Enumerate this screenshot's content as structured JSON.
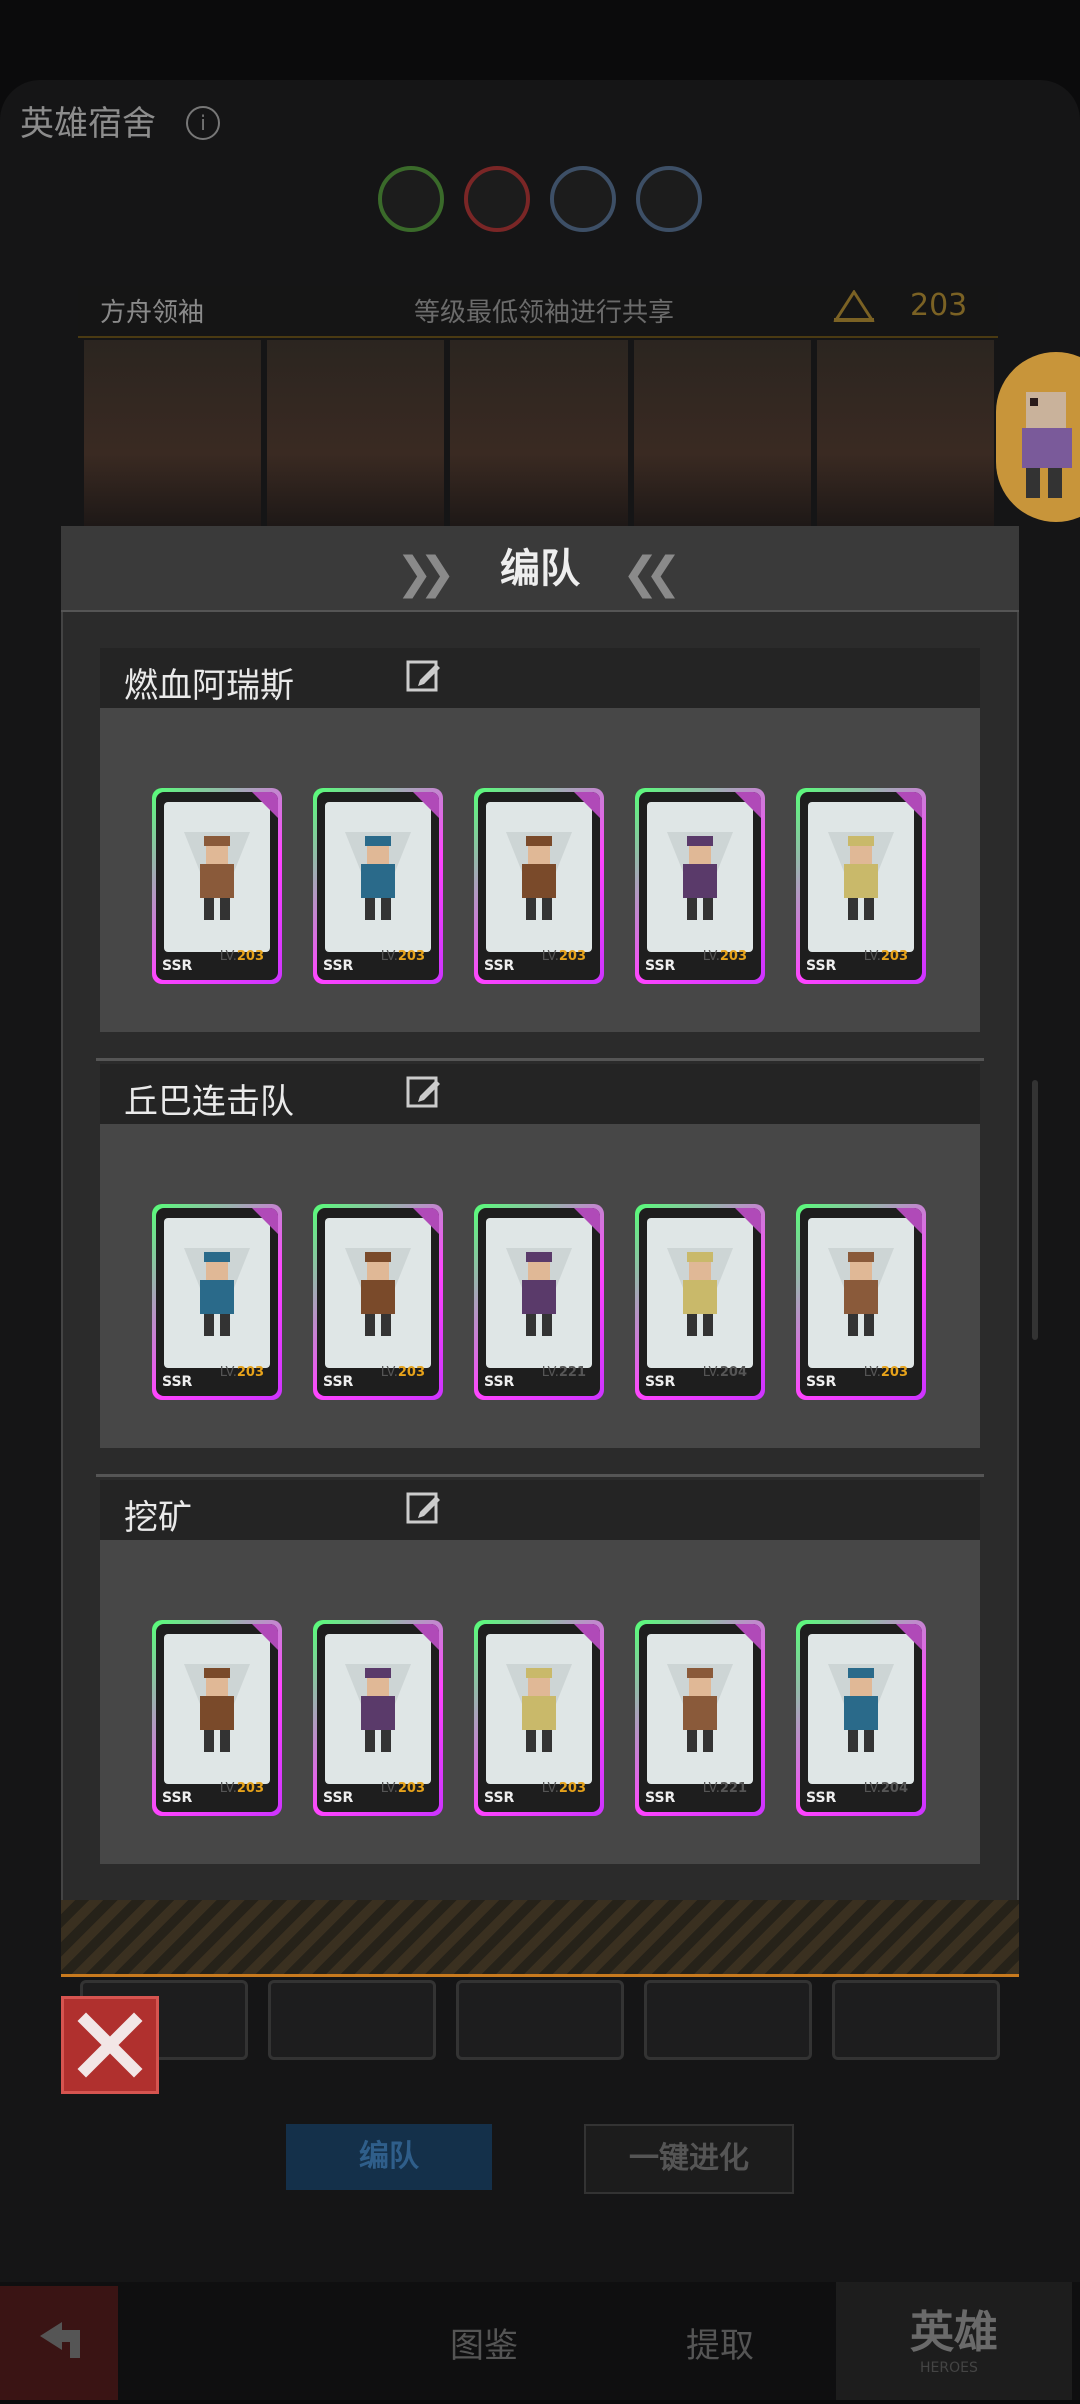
{
  "background": {
    "title": "英雄宿舍",
    "leader": {
      "name": "方舟领袖",
      "desc": "等级最低领袖进行共享",
      "level": "203"
    },
    "tabs": {
      "formation": "编队",
      "evolve": "一键进化"
    },
    "nav": {
      "catalog": "图鉴",
      "extract": "提取",
      "heroes": "英雄",
      "heroes_sub": "HEROES"
    }
  },
  "modal": {
    "title": "编队",
    "teams": [
      {
        "name": "燃血阿瑞斯",
        "cards": [
          {
            "rarity": "SSR",
            "lv_prefix": "LV.",
            "level": "203"
          },
          {
            "rarity": "SSR",
            "lv_prefix": "LV.",
            "level": "203"
          },
          {
            "rarity": "SSR",
            "lv_prefix": "LV.",
            "level": "203"
          },
          {
            "rarity": "SSR",
            "lv_prefix": "LV.",
            "level": "203"
          },
          {
            "rarity": "SSR",
            "lv_prefix": "LV.",
            "level": "203"
          }
        ]
      },
      {
        "name": "丘巴连击队",
        "cards": [
          {
            "rarity": "SSR",
            "lv_prefix": "LV.",
            "level": "203"
          },
          {
            "rarity": "SSR",
            "lv_prefix": "LV.",
            "level": "203"
          },
          {
            "rarity": "SSR",
            "lv_prefix": "LV.",
            "level": "221"
          },
          {
            "rarity": "SSR",
            "lv_prefix": "LV.",
            "level": "204"
          },
          {
            "rarity": "SSR",
            "lv_prefix": "LV.",
            "level": "203"
          }
        ]
      },
      {
        "name": "挖矿",
        "cards": [
          {
            "rarity": "SSR",
            "lv_prefix": "LV.",
            "level": "203"
          },
          {
            "rarity": "SSR",
            "lv_prefix": "LV.",
            "level": "203"
          },
          {
            "rarity": "SSR",
            "lv_prefix": "LV.",
            "level": "203"
          },
          {
            "rarity": "SSR",
            "lv_prefix": "LV.",
            "level": "221"
          },
          {
            "rarity": "SSR",
            "lv_prefix": "LV.",
            "level": "204"
          }
        ]
      }
    ]
  },
  "colors": {
    "accent_gold": "#e6a21a",
    "close_red": "#b0302e",
    "card_pink": "#ff44ff",
    "card_green": "#55ff77"
  }
}
